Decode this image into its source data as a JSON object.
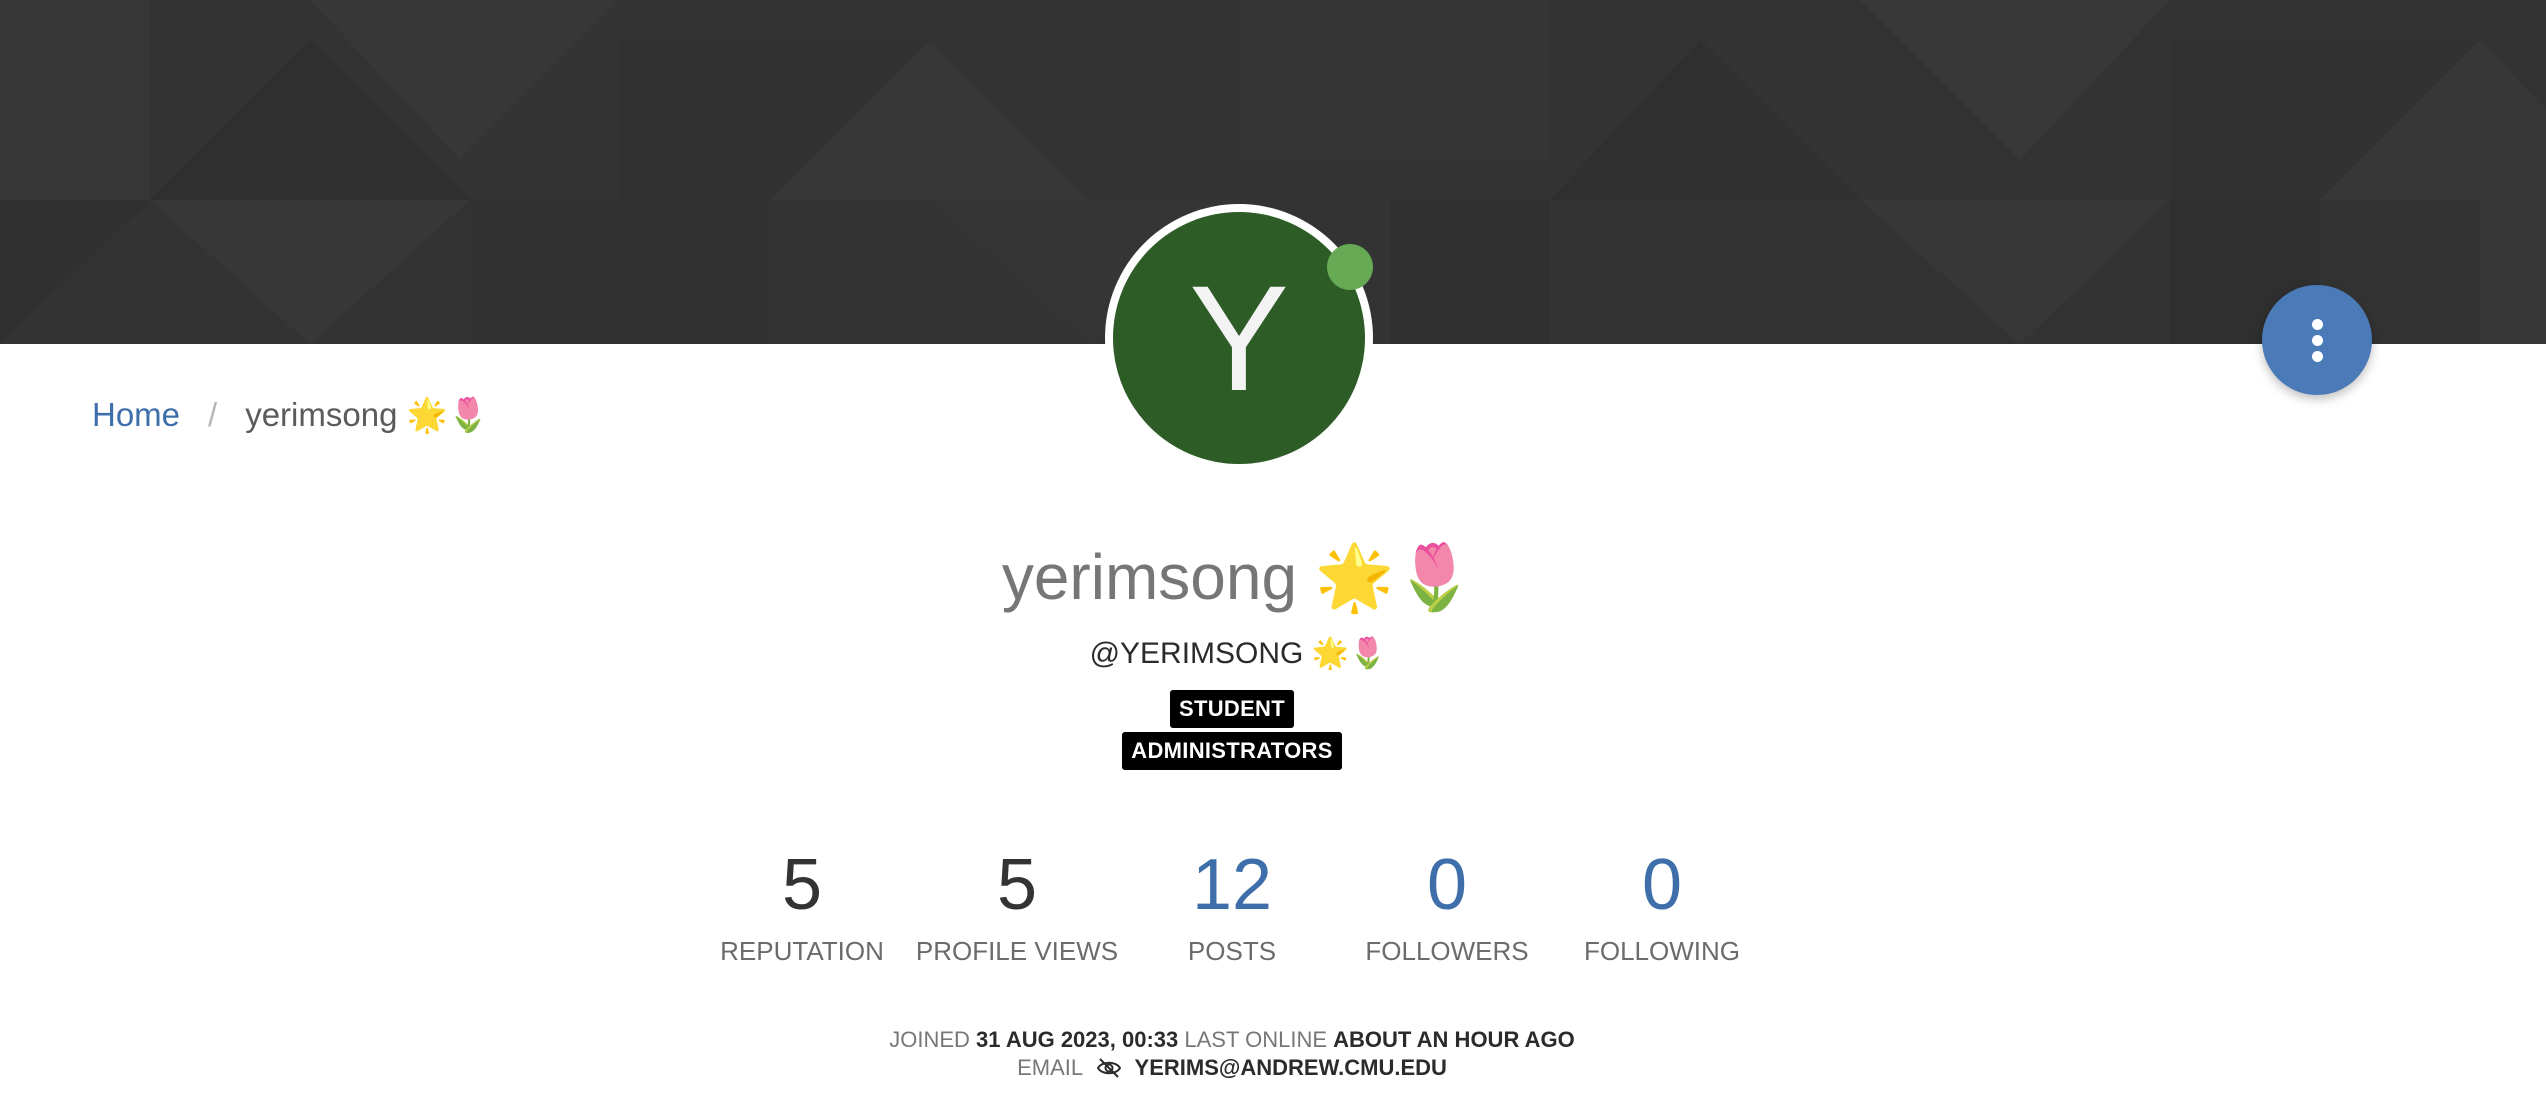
{
  "breadcrumb": {
    "home": "Home",
    "current": "yerimsong 🌟🌷"
  },
  "profile": {
    "avatar_letter": "Y",
    "avatar_color": "#2e5c27",
    "status_color": "#66aa55",
    "fullname": "yerimsong 🌟🌷",
    "username": "@YERIMSONG 🌟🌷",
    "groups": [
      "STUDENT",
      "ADMINISTRATORS"
    ]
  },
  "stats": [
    {
      "value": "5",
      "label": "REPUTATION"
    },
    {
      "value": "5",
      "label": "PROFILE VIEWS"
    },
    {
      "value": "12",
      "label": "POSTS"
    },
    {
      "value": "0",
      "label": "FOLLOWERS"
    },
    {
      "value": "0",
      "label": "FOLLOWING"
    }
  ],
  "meta": {
    "joined_label": "JOINED",
    "joined_value": "31 AUG 2023, 00:33",
    "last_online_label": "LAST ONLINE",
    "last_online_value": "ABOUT AN HOUR AGO",
    "email_label": "EMAIL",
    "email_value": "YERIMS@ANDREW.CMU.EDU"
  },
  "icons": {
    "fab": "kebab-menu-icon",
    "email_visibility": "eye-slash-icon"
  },
  "colors": {
    "accent": "#3e6fab",
    "fab": "#4a7ab8",
    "cover": "#333333",
    "badge": "#000000"
  }
}
